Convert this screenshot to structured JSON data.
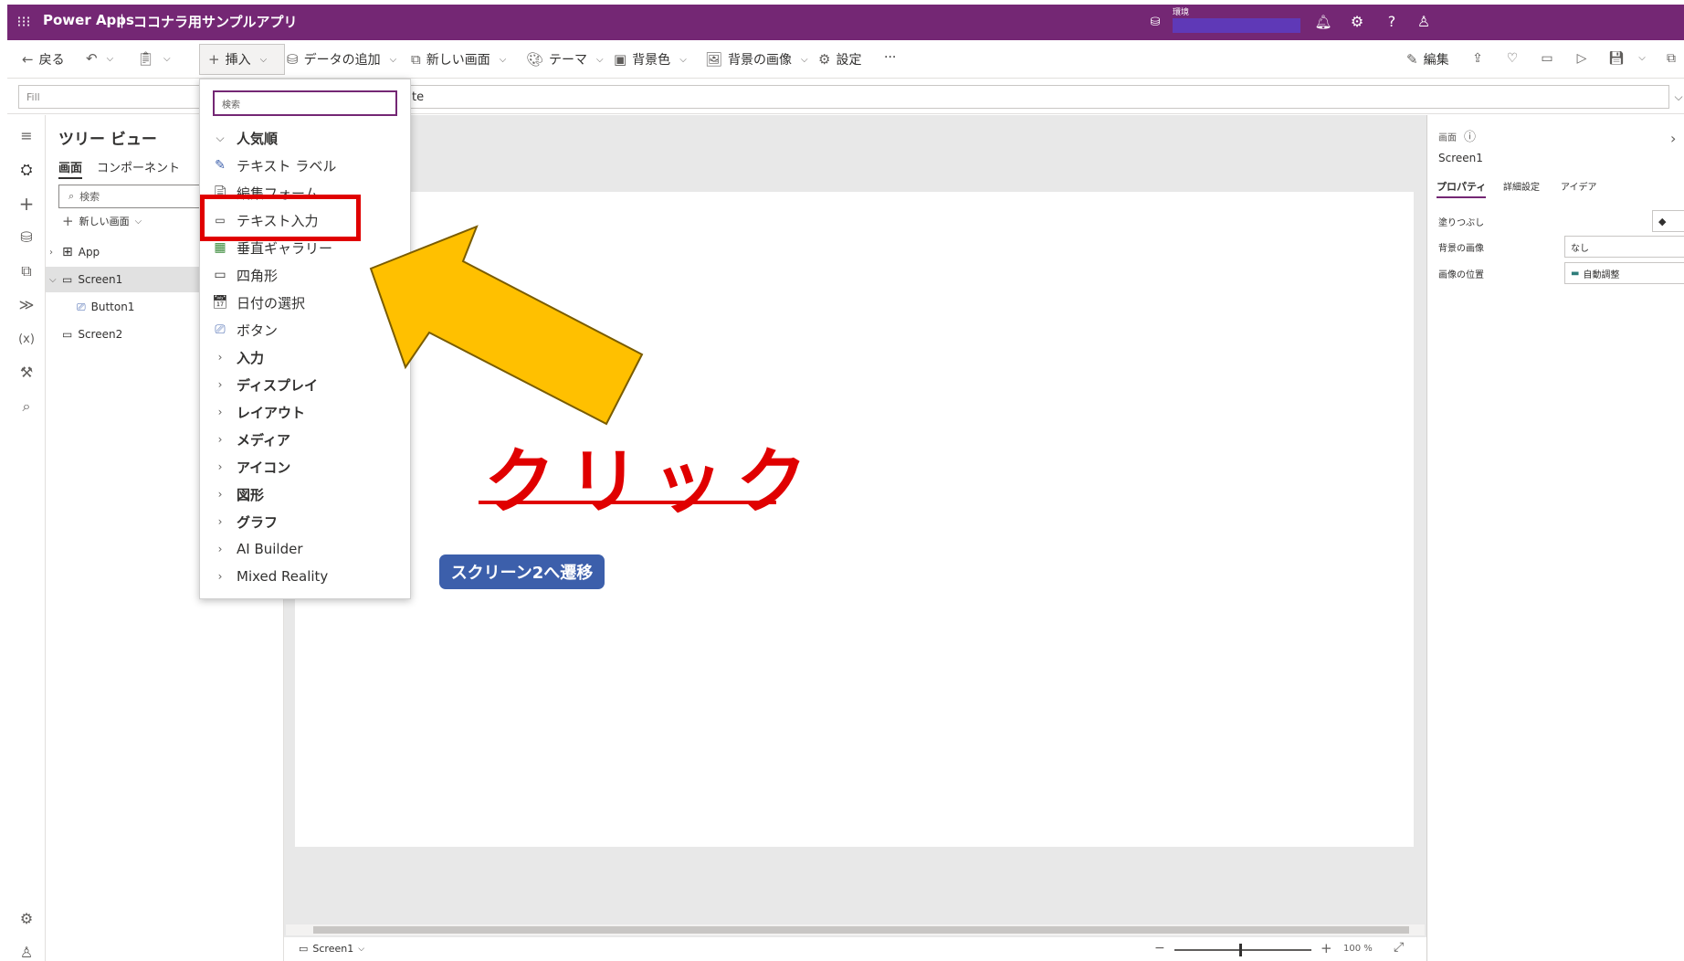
{
  "titlebar": {
    "app_name": "Power Apps",
    "separator": "|",
    "app_title": "ココナラ用サンプルアプリ",
    "env_label": "環境",
    "env_value": ""
  },
  "toolbar": {
    "back": "戻る",
    "insert": "挿入",
    "add_data": "データの追加",
    "new_screen": "新しい画面",
    "theme": "テーマ",
    "bg_color": "背景色",
    "bg_image": "背景の画像",
    "settings": "設定",
    "more": "···",
    "edit": "編集"
  },
  "formula": {
    "property": "Fill",
    "value_tail": "te"
  },
  "tree": {
    "title": "ツリー ビュー",
    "tabs": [
      "画面",
      "コンポーネント"
    ],
    "search_placeholder": "検索",
    "new_screen": "新しい画面",
    "items": [
      {
        "label": "App"
      },
      {
        "label": "Screen1"
      },
      {
        "label": "Button1"
      },
      {
        "label": "Screen2"
      }
    ]
  },
  "insert_menu": {
    "search_placeholder": "検索",
    "popular_header": "人気順",
    "popular_items": [
      {
        "label": "テキスト ラベル",
        "icon": "text-label-icon"
      },
      {
        "label": "編集フォーム",
        "icon": "edit-form-icon"
      },
      {
        "label": "テキスト入力",
        "icon": "text-input-icon"
      },
      {
        "label": "垂直ギャラリー",
        "icon": "vertical-gallery-icon"
      },
      {
        "label": "四角形",
        "icon": "rectangle-icon"
      },
      {
        "label": "日付の選択",
        "icon": "calendar-icon"
      },
      {
        "label": "ボタン",
        "icon": "button-icon"
      }
    ],
    "categories": [
      "入力",
      "ディスプレイ",
      "レイアウト",
      "メディア",
      "アイコン",
      "図形",
      "グラフ",
      "AI Builder",
      "Mixed Reality"
    ]
  },
  "annotation": {
    "click_text": "クリック",
    "highlight_color": "#e00000",
    "arrow_color": "#ffc000"
  },
  "canvas": {
    "button_label": "スクリーン2へ遷移"
  },
  "props": {
    "section": "画面",
    "screen_name": "Screen1",
    "tabs": [
      "プロパティ",
      "詳細設定",
      "アイデア"
    ],
    "rows": [
      {
        "label": "塗りつぶし",
        "value": ""
      },
      {
        "label": "背景の画像",
        "value": "なし"
      },
      {
        "label": "画像の位置",
        "value": "自動調整"
      }
    ]
  },
  "status": {
    "screen": "Screen1",
    "zoom": "100 %"
  },
  "colors": {
    "brand": "#742774",
    "canvas_button": "#3c5fab"
  }
}
